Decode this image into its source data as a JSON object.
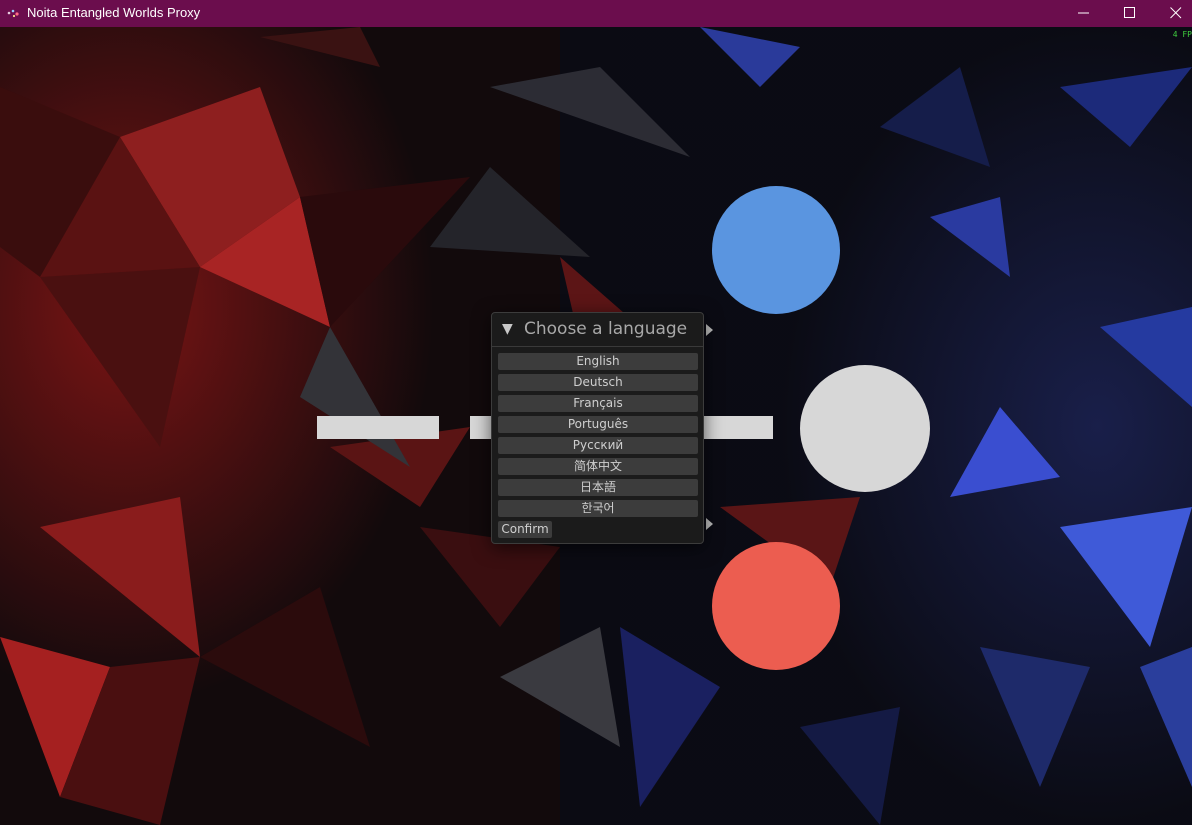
{
  "window": {
    "title": "Noita Entangled Worlds Proxy",
    "fps_label": "4 FP"
  },
  "dialog": {
    "title": "Choose a language",
    "collapse_glyph": "▼",
    "languages": [
      "English",
      "Deutsch",
      "Français",
      "Português",
      "Русский",
      "简体中文",
      "日本語",
      "한국어"
    ],
    "confirm_label": "Confirm"
  },
  "colors": {
    "titlebar": "#6b0d4d",
    "blue_circle": "#5a95e0",
    "gray_circle": "#d7d7d7",
    "red_circle": "#ec5d50"
  }
}
